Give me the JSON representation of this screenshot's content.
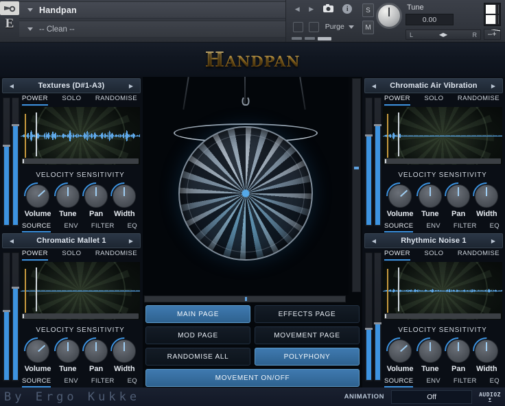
{
  "header": {
    "wrench_icon": "wrench-icon",
    "logo_letter": "E",
    "instrument_name": "Handpan",
    "preset_name": "-- Clean --",
    "prev_arrow": "◀",
    "next_arrow": "▶",
    "camera_icon": "●",
    "info_icon": "i",
    "purge_label": "Purge",
    "solo_button": "S",
    "mute_button": "M",
    "tune_label": "Tune",
    "tune_value": "0.00",
    "pan_left": "L",
    "pan_right": "R",
    "pan_center": "◀▶",
    "volume_minus": "–",
    "volume_plus": "+"
  },
  "banner": {
    "title": "Handpan"
  },
  "modules": [
    {
      "id": "textures",
      "title": "Textures (D#1-A3)",
      "prev": "◀",
      "next": "▶",
      "tabs_top": [
        {
          "label": "POWER",
          "active": true
        },
        {
          "label": "SOLO",
          "active": false
        },
        {
          "label": "RANDOMISE",
          "active": false
        }
      ],
      "velocity_label": "VELOCITY SENSITIVITY",
      "knobs": [
        {
          "label": "Volume",
          "angle": 48
        },
        {
          "label": "Tune",
          "angle": 0
        },
        {
          "label": "Pan",
          "angle": 0
        },
        {
          "label": "Width",
          "angle": 0
        }
      ],
      "tabs_bottom": [
        {
          "label": "SOURCE",
          "active": true
        },
        {
          "label": "ENV",
          "active": false
        },
        {
          "label": "FILTER",
          "active": false
        },
        {
          "label": "EQ",
          "active": false
        }
      ],
      "fader_levels": [
        62,
        78
      ]
    },
    {
      "id": "chromatic-air-vibration",
      "title": "Chromatic Air Vibration",
      "prev": "◀",
      "next": "▶",
      "tabs_top": [
        {
          "label": "POWER",
          "active": true
        },
        {
          "label": "SOLO",
          "active": false
        },
        {
          "label": "RANDOMISE",
          "active": false
        }
      ],
      "velocity_label": "VELOCITY SENSITIVITY",
      "knobs": [
        {
          "label": "Volume",
          "angle": 48
        },
        {
          "label": "Tune",
          "angle": 0
        },
        {
          "label": "Pan",
          "angle": 0
        },
        {
          "label": "Width",
          "angle": 0
        }
      ],
      "tabs_bottom": [
        {
          "label": "SOURCE",
          "active": true
        },
        {
          "label": "ENV",
          "active": false
        },
        {
          "label": "FILTER",
          "active": false
        },
        {
          "label": "EQ",
          "active": false
        }
      ],
      "fader_levels": [
        70,
        78
      ]
    },
    {
      "id": "chromatic-mallet-1",
      "title": "Chromatic Mallet 1",
      "prev": "◀",
      "next": "▶",
      "tabs_top": [
        {
          "label": "POWER",
          "active": true
        },
        {
          "label": "SOLO",
          "active": false
        },
        {
          "label": "RANDOMISE",
          "active": false
        }
      ],
      "velocity_label": "VELOCITY SENSITIVITY",
      "knobs": [
        {
          "label": "Volume",
          "angle": 48
        },
        {
          "label": "Tune",
          "angle": 0
        },
        {
          "label": "Pan",
          "angle": 0
        },
        {
          "label": "Width",
          "angle": 0
        }
      ],
      "tabs_bottom": [
        {
          "label": "SOURCE",
          "active": true
        },
        {
          "label": "ENV",
          "active": false
        },
        {
          "label": "FILTER",
          "active": false
        },
        {
          "label": "EQ",
          "active": false
        }
      ],
      "fader_levels": [
        54,
        72
      ]
    },
    {
      "id": "rhythmic-noise-1",
      "title": "Rhythmic Noise 1",
      "prev": "◀",
      "next": "▶",
      "tabs_top": [
        {
          "label": "POWER",
          "active": true
        },
        {
          "label": "SOLO",
          "active": false
        },
        {
          "label": "RANDOMISE",
          "active": false
        }
      ],
      "velocity_label": "VELOCITY SENSITIVITY",
      "knobs": [
        {
          "label": "Volume",
          "angle": 48
        },
        {
          "label": "Tune",
          "angle": 0
        },
        {
          "label": "Pan",
          "angle": 0
        },
        {
          "label": "Width",
          "angle": 0
        }
      ],
      "tabs_bottom": [
        {
          "label": "SOURCE",
          "active": true
        },
        {
          "label": "ENV",
          "active": false
        },
        {
          "label": "FILTER",
          "active": false
        },
        {
          "label": "EQ",
          "active": false
        }
      ],
      "fader_levels": [
        40,
        44
      ]
    }
  ],
  "center": {
    "artwork_name": "handpan-artwork",
    "buttons": [
      {
        "label": "MAIN PAGE",
        "active": true
      },
      {
        "label": "EFFECTS PAGE",
        "active": false
      },
      {
        "label": "MOD PAGE",
        "active": false
      },
      {
        "label": "MOVEMENT PAGE",
        "active": false
      },
      {
        "label": "RANDOMISE ALL",
        "active": false
      },
      {
        "label": "POLYPHONY",
        "active": true
      },
      {
        "label": "MOVEMENT ON/OFF",
        "active": true
      }
    ]
  },
  "footer": {
    "credit": "By Ergo Kukke",
    "animation_label": "ANIMATION",
    "animation_value": "Off",
    "watermark": "AUDIOZ",
    "watermark_sub": "▼"
  },
  "colors": {
    "accent_blue": "#3d93e0",
    "button_active": "#3f7ab0",
    "gold": "#cf9a30",
    "panel_bg": "#0a0e15"
  }
}
